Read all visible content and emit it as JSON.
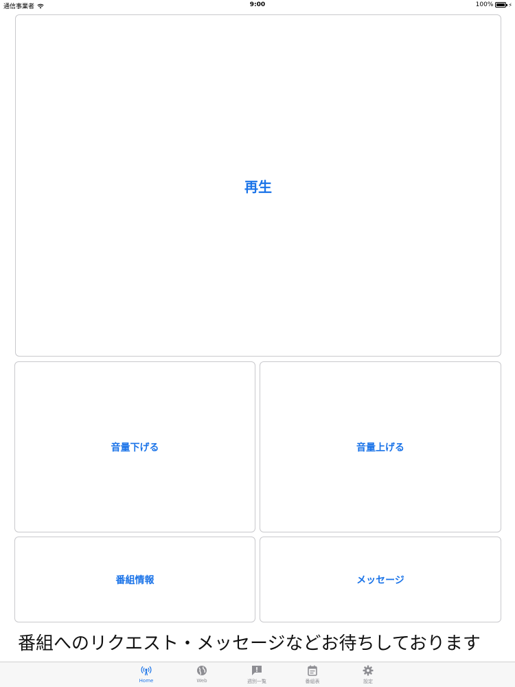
{
  "status": {
    "carrier": "通信事業者",
    "time": "9:00",
    "battery": "100%"
  },
  "buttons": {
    "play": "再生",
    "volume_down": "音量下げる",
    "volume_up": "音量上げる",
    "program_info": "番組情報",
    "message": "メッセージ"
  },
  "marquee": "番組へのリクエスト・メッセージなどお待ちしております",
  "tabs": [
    {
      "label": "Home",
      "icon": "antenna-icon",
      "active": true
    },
    {
      "label": "Web",
      "icon": "globe-icon",
      "active": false
    },
    {
      "label": "週別一覧",
      "icon": "message-alert-icon",
      "active": false
    },
    {
      "label": "番組表",
      "icon": "calendar-icon",
      "active": false
    },
    {
      "label": "設定",
      "icon": "gear-icon",
      "active": false
    }
  ],
  "colors": {
    "accent": "#1a73e8",
    "inactive": "#8e8e93",
    "tabbar_bg": "#f7f7f7"
  }
}
